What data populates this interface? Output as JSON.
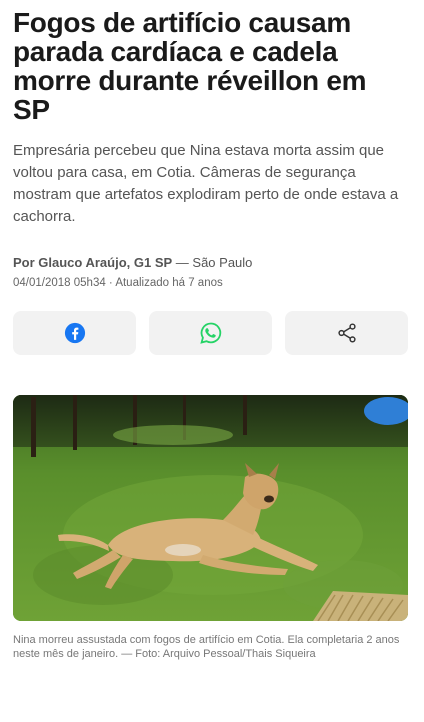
{
  "article": {
    "headline": "Fogos de artifício causam parada cardíaca e cadela morre durante réveillon em SP",
    "subtitle": "Empresária percebeu que Nina estava morta assim que voltou para casa, em Cotia. Câmeras de segurança mostram que artefatos explodiram perto de onde estava a cachorra.",
    "byline": {
      "author": "Por Glauco Araújo, G1 SP",
      "location": "— São Paulo"
    },
    "dateline": "04/01/2018 05h34 · Atualizado há 7 anos"
  },
  "share": {
    "buttons": [
      {
        "icon": "facebook-icon",
        "color": "#1877f2"
      },
      {
        "icon": "whatsapp-icon",
        "color": "#25d366"
      },
      {
        "icon": "share-icon",
        "color": "#333333"
      }
    ]
  },
  "photo": {
    "caption": "Nina morreu assustada com fogos de artifício em Cotia. Ela completaria 2 anos neste mês de janeiro. — Foto: Arquivo Pessoal/Thais Siqueira"
  }
}
